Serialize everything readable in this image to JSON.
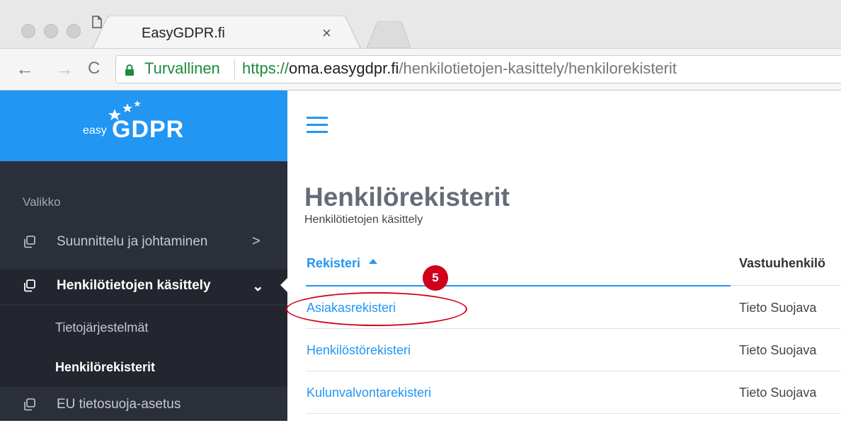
{
  "browser": {
    "tab_title": "EasyGDPR.fi",
    "tab_close": "×",
    "secure_label": "Turvallinen",
    "url_scheme": "https://",
    "url_host": "oma.easygdpr.fi",
    "url_path": "/henkilotietojen-kasittely/henkilorekisterit",
    "back": "←",
    "forward": "→",
    "reload": "C"
  },
  "logo": {
    "easy": "easy",
    "gdpr": "GDPR",
    "brand_color": "#2196f3"
  },
  "sidebar": {
    "heading": "Valikko",
    "items": [
      {
        "label": "Suunnittelu ja johtaminen",
        "chevron": ">",
        "icon": "copy-icon"
      },
      {
        "label": "Henkilötietojen käsittely",
        "chevron": "⌄",
        "icon": "copy-icon"
      },
      {
        "label": "EU tietosuoja-asetus",
        "icon": "copy-icon"
      }
    ],
    "subitems": [
      {
        "label": "Tietojärjestelmät"
      },
      {
        "label": "Henkilörekisterit"
      }
    ]
  },
  "main": {
    "title": "Henkilörekisterit",
    "subtitle": "Henkilötietojen käsittely",
    "table": {
      "headers": [
        "Rekisteri",
        "Vastuuhenkilö"
      ],
      "rows": [
        {
          "name": "Asiakasrekisteri",
          "responsible": "Tieto Suojava"
        },
        {
          "name": "Henkilöstörekisteri",
          "responsible": "Tieto Suojava"
        },
        {
          "name": "Kulunvalvontarekisteri",
          "responsible": "Tieto Suojava"
        }
      ]
    }
  },
  "annotation": {
    "badge": "5",
    "color": "#d0021b"
  }
}
